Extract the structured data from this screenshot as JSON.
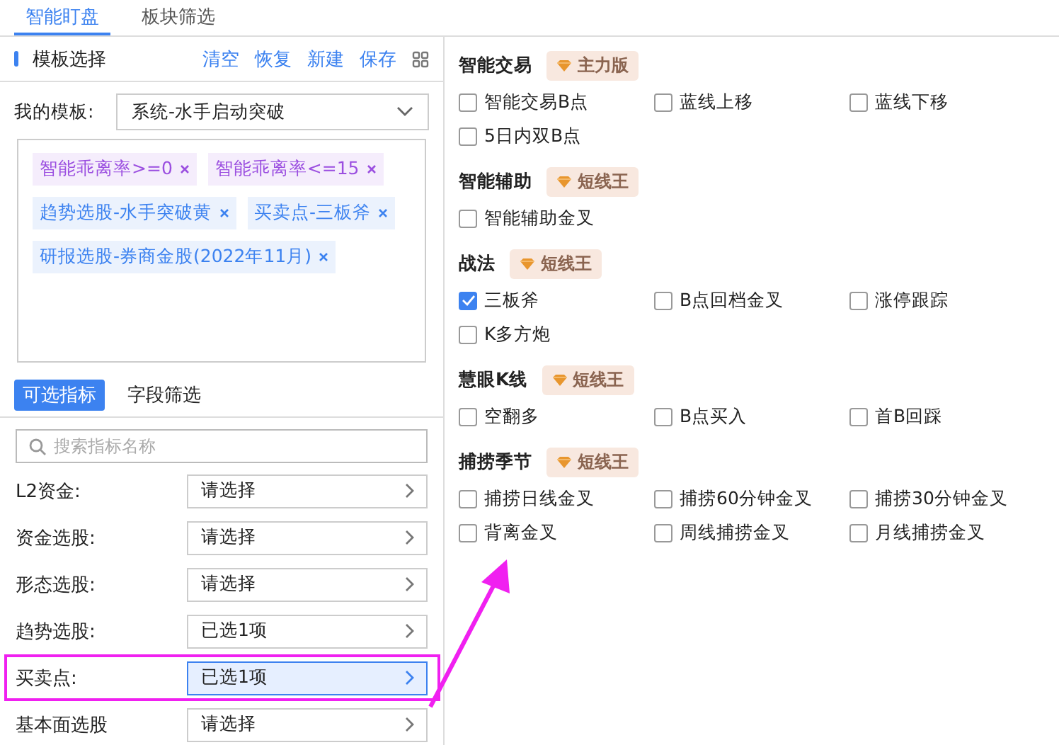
{
  "tabs": [
    {
      "label": "智能盯盘",
      "selected": true
    },
    {
      "label": "板块筛选",
      "selected": false
    }
  ],
  "template_panel": {
    "title": "模板选择",
    "actions": [
      "清空",
      "恢复",
      "新建",
      "保存"
    ],
    "my_template_label": "我的模板:",
    "my_template_value": "系统-水手启动突破",
    "tags": [
      {
        "label": "智能乖离率>=0",
        "color": "#9b4fe0"
      },
      {
        "label": "智能乖离率<=15",
        "color": "#9b4fe0"
      },
      {
        "label": "趋势选股-水手突破黄",
        "color": "#3c82f0"
      },
      {
        "label": "买卖点-三板斧",
        "color": "#3c82f0"
      },
      {
        "label": "研报选股-券商金股(2022年11月)",
        "color": "#3c82f0"
      }
    ]
  },
  "indicator_tabs": [
    {
      "label": "可选指标",
      "selected": true
    },
    {
      "label": "字段筛选",
      "selected": false
    }
  ],
  "search": {
    "placeholder": "搜索指标名称"
  },
  "filters": [
    {
      "label": "L2资金:",
      "value": "请选择",
      "selected": false,
      "highlighted": false
    },
    {
      "label": "资金选股:",
      "value": "请选择",
      "selected": false,
      "highlighted": false
    },
    {
      "label": "形态选股:",
      "value": "请选择",
      "selected": false,
      "highlighted": false
    },
    {
      "label": "趋势选股:",
      "value": "已选1项",
      "selected": false,
      "highlighted": false
    },
    {
      "label": "买卖点:",
      "value": "已选1项",
      "selected": true,
      "highlighted": true
    },
    {
      "label": "基本面选股",
      "value": "请选择",
      "selected": false,
      "highlighted": false
    }
  ],
  "sections": [
    {
      "title": "智能交易",
      "badge": "主力版",
      "options": [
        {
          "label": "智能交易B点",
          "checked": false
        },
        {
          "label": "蓝线上移",
          "checked": false
        },
        {
          "label": "蓝线下移",
          "checked": false
        },
        {
          "label": "5日内双B点",
          "checked": false
        }
      ]
    },
    {
      "title": "智能辅助",
      "badge": "短线王",
      "options": [
        {
          "label": "智能辅助金叉",
          "checked": false
        }
      ]
    },
    {
      "title": "战法",
      "badge": "短线王",
      "options": [
        {
          "label": "三板斧",
          "checked": true
        },
        {
          "label": "B点回档金叉",
          "checked": false
        },
        {
          "label": "涨停跟踪",
          "checked": false
        },
        {
          "label": "K多方炮",
          "checked": false
        }
      ]
    },
    {
      "title": "慧眼K线",
      "badge": "短线王",
      "options": [
        {
          "label": "空翻多",
          "checked": false
        },
        {
          "label": "B点买入",
          "checked": false
        },
        {
          "label": "首B回踩",
          "checked": false
        }
      ]
    },
    {
      "title": "捕捞季节",
      "badge": "短线王",
      "options": [
        {
          "label": "捕捞日线金叉",
          "checked": false
        },
        {
          "label": "捕捞60分钟金叉",
          "checked": false
        },
        {
          "label": "捕捞30分钟金叉",
          "checked": false
        },
        {
          "label": "背离金叉",
          "checked": false
        },
        {
          "label": "周线捕捞金叉",
          "checked": false
        },
        {
          "label": "月线捕捞金叉",
          "checked": false
        }
      ]
    }
  ]
}
